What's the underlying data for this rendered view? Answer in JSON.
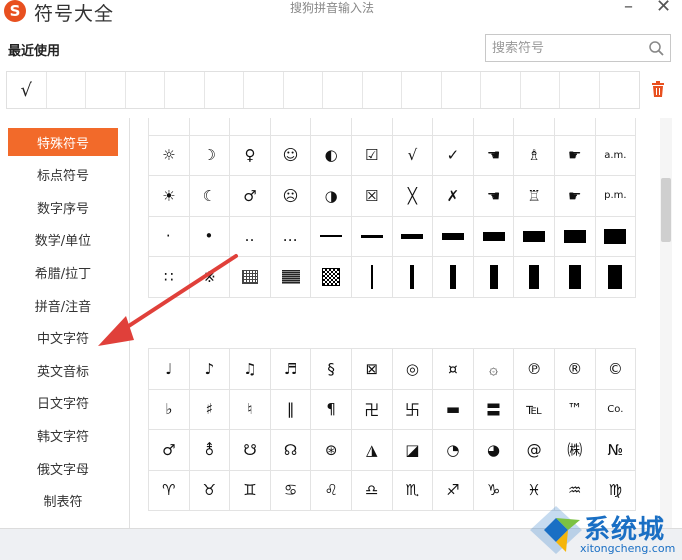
{
  "window": {
    "logo_letter": "S",
    "title": "符号大全",
    "subtitle": "搜狗拼音输入法",
    "minimize": "–",
    "close": "✕"
  },
  "recent": {
    "title": "最近使用",
    "items": [
      "√",
      "",
      "",
      "",
      "",
      "",
      "",
      "",
      "",
      "",
      "",
      "",
      "",
      "",
      "",
      ""
    ]
  },
  "search": {
    "placeholder": "搜索符号",
    "icon": "search-icon"
  },
  "sidebar": {
    "items": [
      {
        "label": "特殊符号",
        "active": true
      },
      {
        "label": "标点符号",
        "active": false
      },
      {
        "label": "数字序号",
        "active": false
      },
      {
        "label": "数学/单位",
        "active": false
      },
      {
        "label": "希腊/拉丁",
        "active": false
      },
      {
        "label": "拼音/注音",
        "active": false
      },
      {
        "label": "中文字符",
        "active": false
      },
      {
        "label": "英文音标",
        "active": false
      },
      {
        "label": "日文字符",
        "active": false
      },
      {
        "label": "韩文字符",
        "active": false
      },
      {
        "label": "俄文字母",
        "active": false
      },
      {
        "label": "制表符",
        "active": false
      }
    ]
  },
  "grid_a": {
    "rows": [
      [
        "—",
        "—",
        "~",
        "~",
        "—",
        "^",
        "-",
        "-",
        "-",
        "-",
        "-",
        "-"
      ],
      [
        "☼",
        "☽",
        "♀",
        "☺",
        "◐",
        "☑",
        "√",
        "✓",
        "☚",
        "♗",
        "☛",
        "a.m."
      ],
      [
        "☀",
        "☾",
        "♂",
        "☹",
        "◑",
        "☒",
        "╳",
        "✗",
        "☚",
        "♖",
        "☛",
        "p.m."
      ]
    ],
    "row_bars": [
      {
        "kind": "dots",
        "values": [
          "·",
          "•",
          "‥",
          "…"
        ]
      },
      {
        "kind": "hbar",
        "values": [
          2,
          3,
          5,
          7,
          9,
          11,
          13,
          15
        ]
      }
    ]
  },
  "grid_a_row5": {
    "cells": [
      "∷",
      "※",
      "mesh",
      "densemesh",
      "checker",
      "v2",
      "v4",
      "v6",
      "v8",
      "v10",
      "v12",
      "v14"
    ]
  },
  "grid_b": {
    "rows": [
      [
        "♩",
        "♪",
        "♫",
        "♬",
        "§",
        "⊠",
        "◎",
        "¤",
        "۞",
        "℗",
        "®",
        "©"
      ],
      [
        "♭",
        "♯",
        "♮",
        "‖",
        "¶",
        "卍",
        "卐",
        "▬",
        "〓",
        "℡",
        "™",
        "Co."
      ],
      [
        "♂",
        "⚨",
        "☋",
        "☊",
        "⊛",
        "◮",
        "◪",
        "◔",
        "◕",
        "@",
        "㈱",
        "№"
      ],
      [
        "♈",
        "♉",
        "♊",
        "♋",
        "♌",
        "♎",
        "♏",
        "♐",
        "♑",
        "♓",
        "♒",
        "♍"
      ]
    ]
  },
  "watermark": {
    "title": "系统城",
    "url": "xitongcheng.com"
  },
  "colors": {
    "accent": "#f26a2a",
    "arrow": "#e0403a",
    "watermark": "#1a6fc4"
  }
}
